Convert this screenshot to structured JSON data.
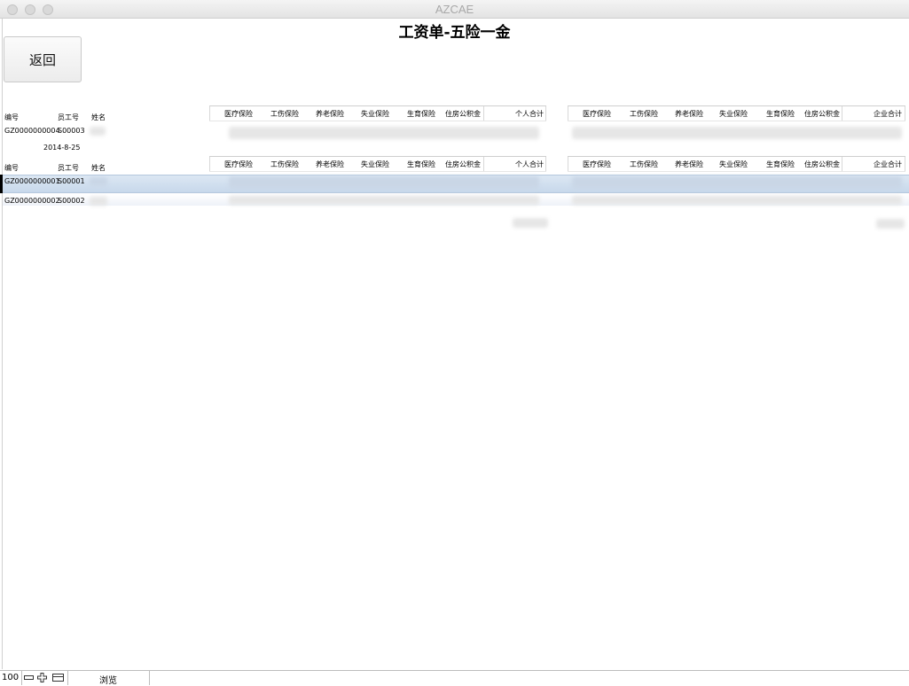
{
  "window": {
    "title": "AZCAE"
  },
  "page": {
    "title": "工资单-五险一金"
  },
  "toolbar": {
    "back_label": "返回"
  },
  "left_headers": {
    "id": "编号",
    "emp_no": "员工号",
    "name": "姓名"
  },
  "personal_headers": [
    "医疗保险",
    "工伤保险",
    "养老保险",
    "失业保险",
    "生育保险",
    "住房公积金",
    "个人合计"
  ],
  "company_headers": [
    "医疗保险",
    "工伤保险",
    "养老保险",
    "失业保险",
    "生育保险",
    "住房公积金",
    "企业合计"
  ],
  "group1": {
    "record": {
      "id": "GZ0000000004",
      "emp_no": "S00003"
    },
    "date": "2014-8-25"
  },
  "rows": [
    {
      "id": "GZ0000000001",
      "emp_no": "S00001",
      "selected": true
    },
    {
      "id": "GZ0000000002",
      "emp_no": "S00002",
      "selected": false
    }
  ],
  "status": {
    "zoom": "100",
    "mode": "浏览"
  },
  "colors": {
    "selection": "#c7d8eb",
    "accent": "#000000"
  }
}
